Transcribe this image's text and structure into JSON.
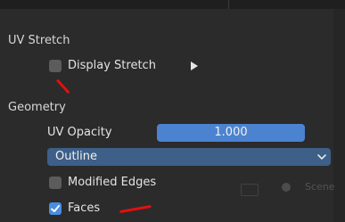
{
  "uv_stretch": {
    "title": "UV Stretch",
    "display_stretch": {
      "label": "Display Stretch",
      "checked": false
    }
  },
  "geometry": {
    "title": "Geometry",
    "uv_opacity": {
      "label": "UV Opacity",
      "value": "1.000"
    },
    "display_mode": {
      "value": "Outline"
    },
    "modified_edges": {
      "label": "Modified Edges",
      "checked": false
    },
    "faces": {
      "label": "Faces",
      "checked": true
    }
  },
  "background_hint": {
    "text": "Scene"
  },
  "colors": {
    "panel_bg": "#2b2b2b",
    "slider_fill": "#4c83d1",
    "dropdown_bg": "#3d5f88",
    "checkbox_checked": "#4a8de0",
    "checkbox_unchecked": "#5c5c5c",
    "annotation_red": "#e01010"
  },
  "icons": [
    "play-icon",
    "chevron-down-icon",
    "checkmark-icon"
  ]
}
